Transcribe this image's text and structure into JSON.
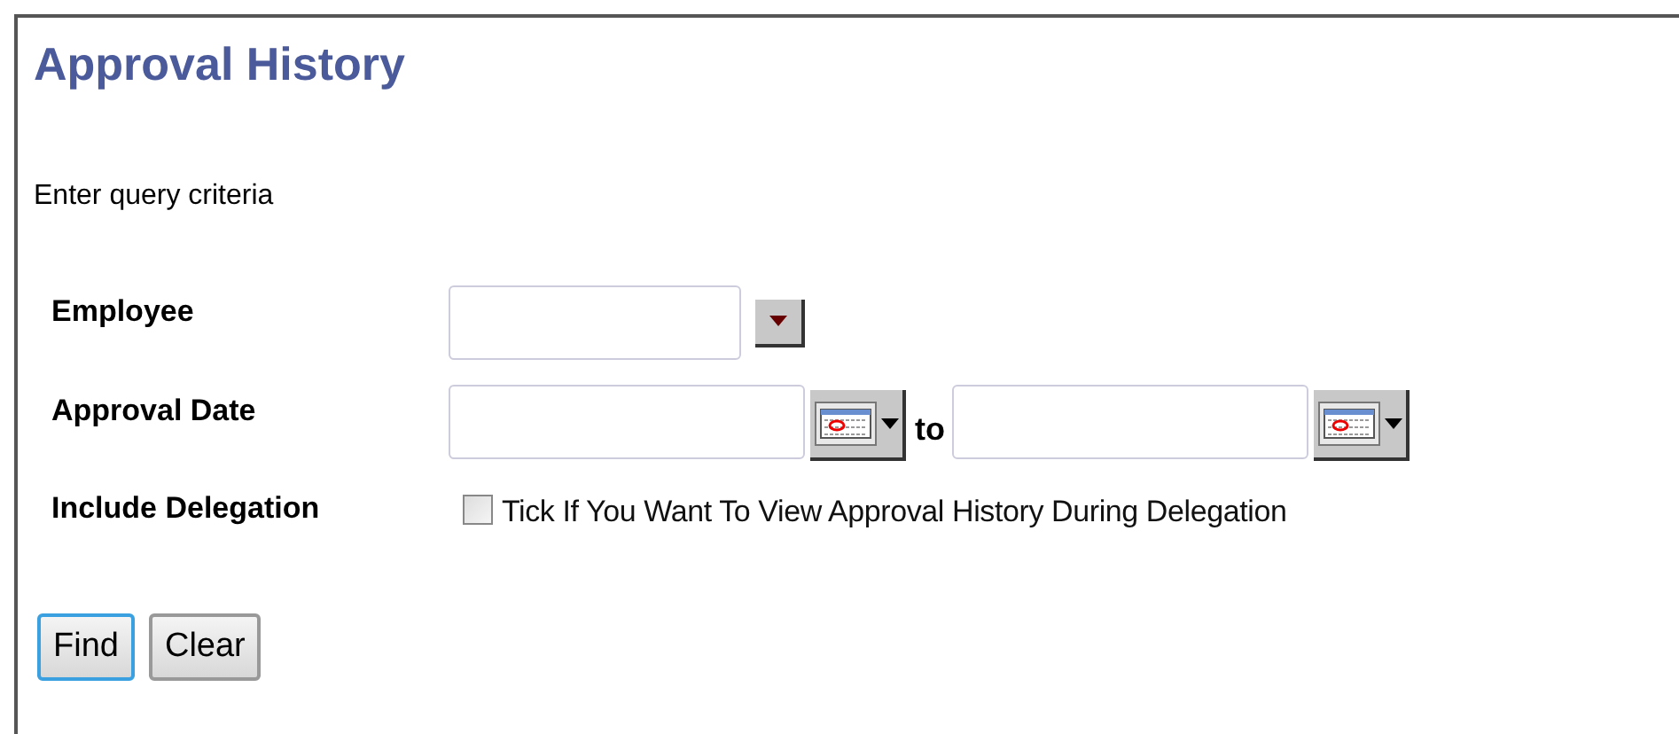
{
  "title": "Approval History",
  "instructions": "Enter query criteria",
  "fields": [
    {
      "kind": "dropdown",
      "label": "Employee"
    },
    {
      "kind": "daterange",
      "label": "Approval Date",
      "separator": "to"
    },
    {
      "kind": "checkbox",
      "label": "Include Delegation",
      "option": "Tick If You Want To View Approval History During Delegation",
      "checked": false
    }
  ],
  "buttons": [
    {
      "label": "Find",
      "focused": true
    },
    {
      "label": "Clear",
      "focused": false
    }
  ]
}
